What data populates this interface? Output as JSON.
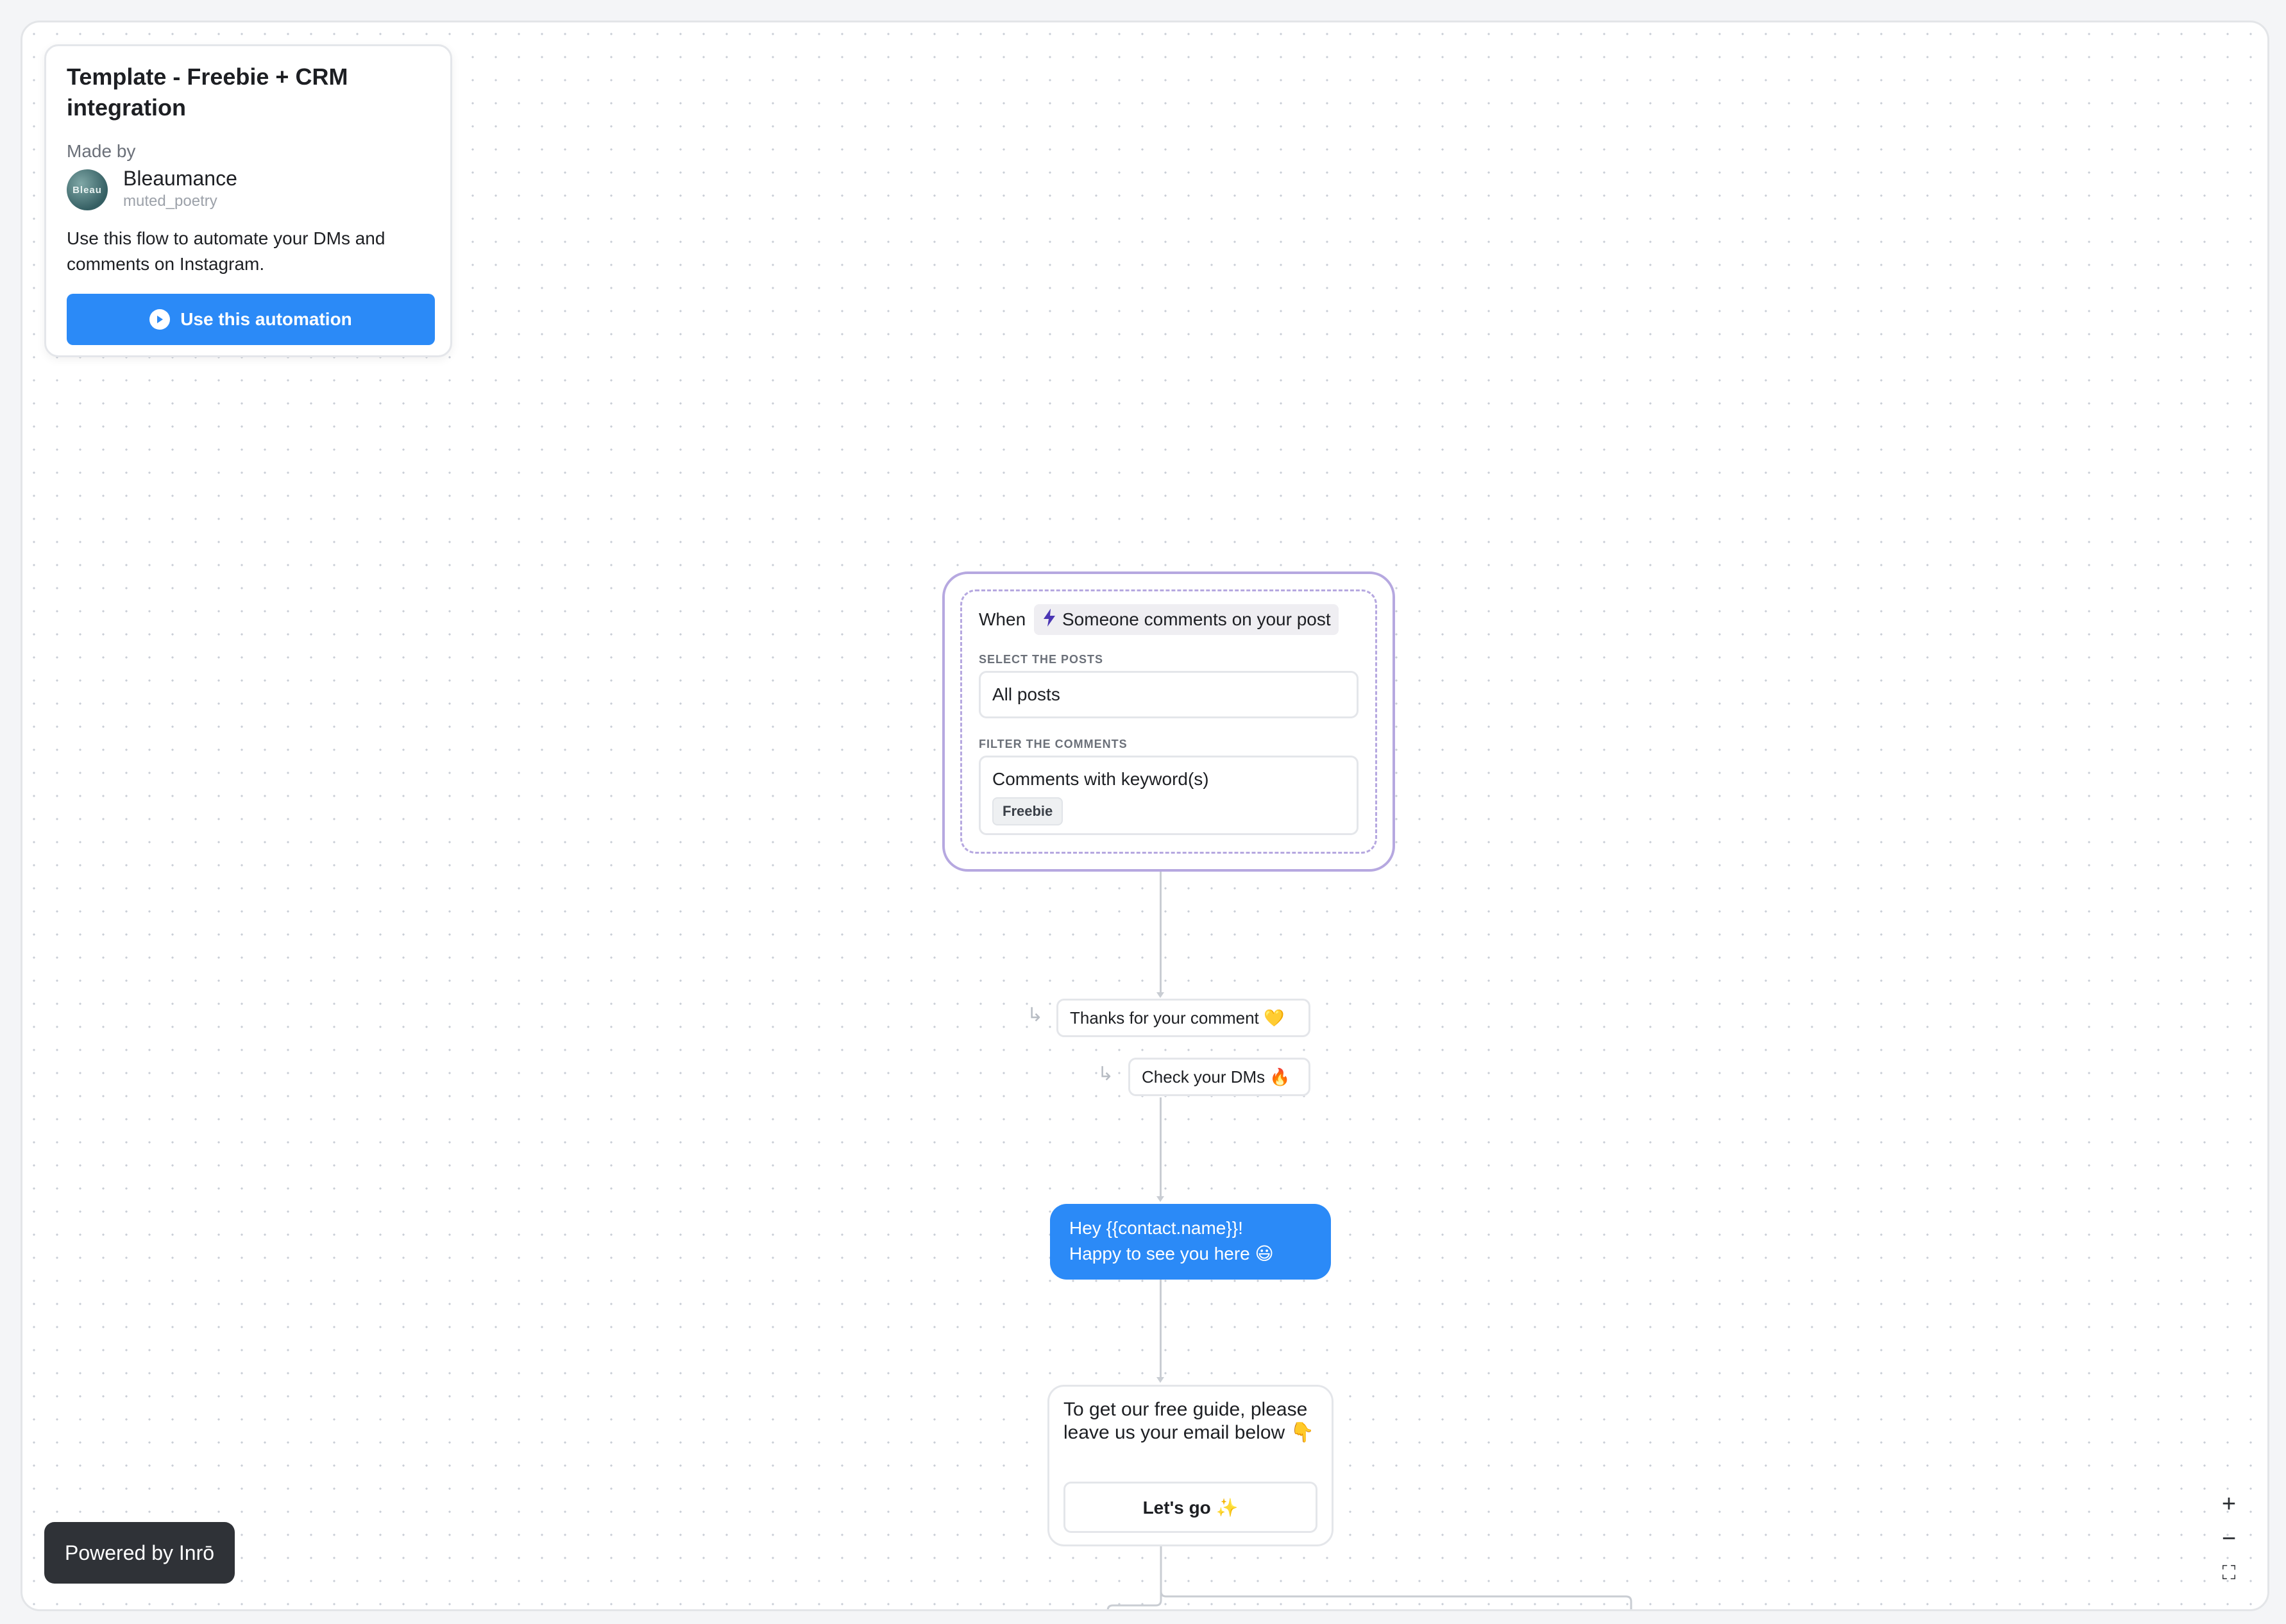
{
  "template_card": {
    "title": "Template - Freebie + CRM integration",
    "made_by_label": "Made by",
    "author_name": "Bleaumance",
    "author_handle": "muted_poetry",
    "avatar_text": "Bleau",
    "description": "Use this flow to automate your DMs and comments on Instagram.",
    "use_button_label": "Use this automation"
  },
  "trigger": {
    "when_label": "When",
    "event_label": "Someone comments on your post",
    "posts_section_label": "SELECT THE POSTS",
    "posts_value": "All posts",
    "filter_section_label": "FILTER THE COMMENTS",
    "filter_value": "Comments with keyword(s)",
    "keyword": "Freebie"
  },
  "replies": [
    {
      "text": "Thanks for your comment 💛"
    },
    {
      "text": "Check your DMs 🔥"
    }
  ],
  "dm_message": {
    "line1": "Hey {{contact.name}}!",
    "line2": "Happy to see you here 😃"
  },
  "prompt": {
    "text": "To get our free guide, please leave us your email below 👇",
    "button_label": "Let's go ✨"
  },
  "footer": {
    "powered_by": "Powered by Inrō"
  },
  "zoom_controls": {
    "zoom_in": "+",
    "zoom_out": "−",
    "fit_view": "⛶"
  },
  "colors": {
    "accent_blue": "#2b8af7",
    "trigger_border": "#b6a8e0",
    "lightning": "#4b36b4",
    "badge_dark": "#2f3237"
  }
}
